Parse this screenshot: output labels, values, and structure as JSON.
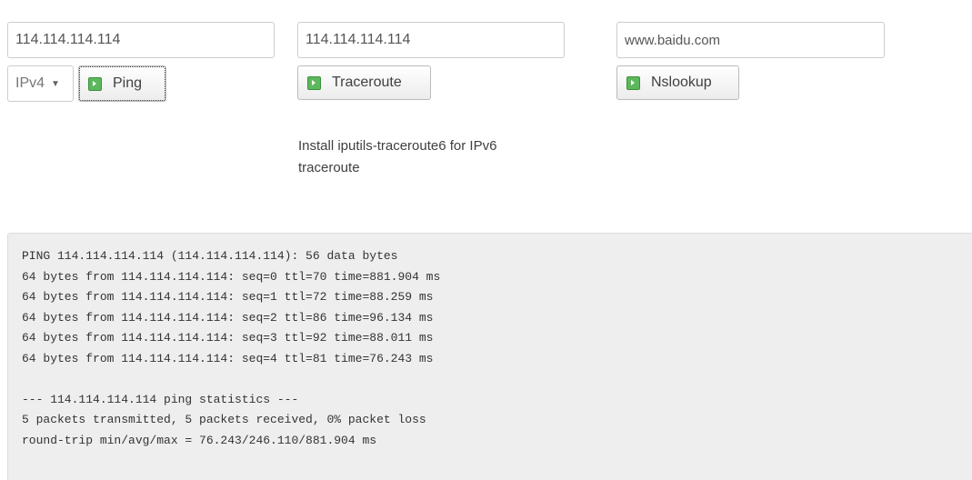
{
  "ping": {
    "address_value": "114.114.114.114",
    "protocol_selected": "IPv4",
    "button_label": "Ping",
    "button_icon": "play-icon"
  },
  "traceroute": {
    "address_value": "114.114.114.114",
    "button_label": "Traceroute",
    "button_icon": "play-icon",
    "note": "Install iputils-traceroute6 for IPv6 traceroute"
  },
  "nslookup": {
    "address_value": "www.baidu.com",
    "button_label": "Nslookup",
    "button_icon": "play-icon"
  },
  "output": {
    "lines": [
      "PING 114.114.114.114 (114.114.114.114): 56 data bytes",
      "64 bytes from 114.114.114.114: seq=0 ttl=70 time=881.904 ms",
      "64 bytes from 114.114.114.114: seq=1 ttl=72 time=88.259 ms",
      "64 bytes from 114.114.114.114: seq=2 ttl=86 time=96.134 ms",
      "64 bytes from 114.114.114.114: seq=3 ttl=92 time=88.011 ms",
      "64 bytes from 114.114.114.114: seq=4 ttl=81 time=76.243 ms",
      "",
      "--- 114.114.114.114 ping statistics ---",
      "5 packets transmitted, 5 packets received, 0% packet loss",
      "round-trip min/avg/max = 76.243/246.110/881.904 ms"
    ]
  },
  "colors": {
    "button_icon_green": "#5cb85c",
    "output_background": "#eeeeee"
  }
}
